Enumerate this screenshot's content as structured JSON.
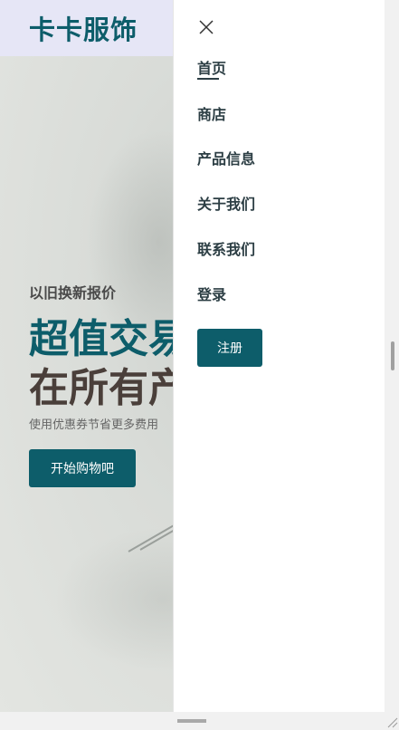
{
  "brand": {
    "name": "卡卡服饰"
  },
  "hero": {
    "subtitle": "以旧换新报价",
    "title_line1": "超值交易",
    "title_line2": "在所有产品",
    "description": "使用优惠券节省更多费用",
    "cta_label": "开始购物吧"
  },
  "drawer": {
    "items": [
      {
        "label": "首页",
        "active": true
      },
      {
        "label": "商店"
      },
      {
        "label": "产品信息"
      },
      {
        "label": "关于我们"
      },
      {
        "label": "联系我们"
      },
      {
        "label": "登录"
      }
    ],
    "register_label": "注册"
  },
  "colors": {
    "accent": "#0d5d6a",
    "topbar": "#e6e6f6",
    "nav_text": "#2c3e44"
  },
  "icons": {
    "close": "close-icon"
  }
}
